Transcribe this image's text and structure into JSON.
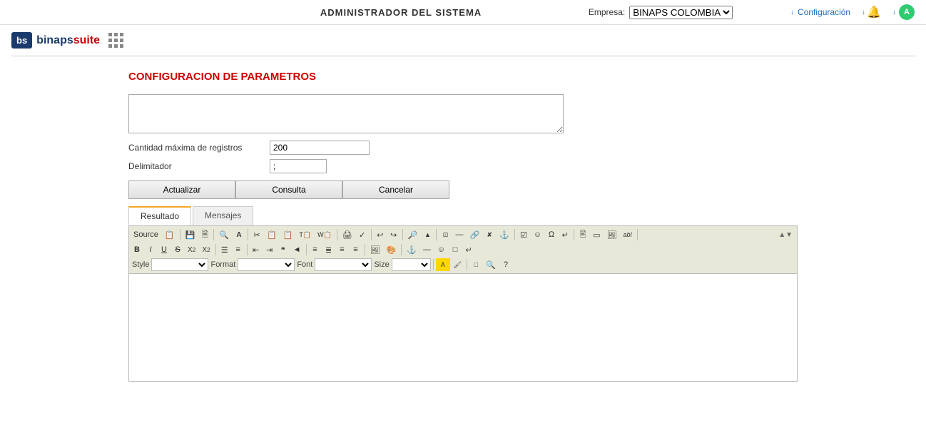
{
  "topbar": {
    "title": "ADMINISTRADOR DEL SISTEMA",
    "empresa_label": "Empresa:",
    "empresa_value": "BINAPS COLOMBIA",
    "empresa_options": [
      "BINAPS COLOMBIA"
    ],
    "configuracion_label": "Configuración",
    "notif_icon": "bell-icon",
    "user_letter": "A"
  },
  "logo": {
    "bs_text": "bs",
    "brand_text1": "binaps",
    "brand_text2": "suite"
  },
  "page": {
    "section_title": "CONFIGURACION DE PARAMETROS"
  },
  "form": {
    "cantidad_label": "Cantidad máxima de registros",
    "cantidad_value": "200",
    "delimitador_label": "Delimitador",
    "delimitador_value": ";"
  },
  "buttons": {
    "actualizar": "Actualizar",
    "consulta": "Consulta",
    "cancelar": "Cancelar"
  },
  "tabs": [
    {
      "label": "Resultado",
      "active": true
    },
    {
      "label": "Mensajes",
      "active": false
    }
  ],
  "editor": {
    "toolbar_row1": [
      {
        "type": "btn",
        "label": "Source",
        "name": "source-btn"
      },
      {
        "type": "btn",
        "icon": "📋",
        "name": "copy-btn"
      },
      {
        "type": "sep"
      },
      {
        "type": "btn",
        "icon": "💾",
        "name": "save-btn"
      },
      {
        "type": "btn",
        "icon": "📄",
        "name": "new-btn"
      },
      {
        "type": "sep"
      },
      {
        "type": "btn",
        "icon": "🔍",
        "name": "find-btn"
      },
      {
        "type": "btn",
        "icon": "A",
        "name": "select-all-btn"
      },
      {
        "type": "sep"
      },
      {
        "type": "btn",
        "icon": "✂",
        "name": "cut-btn"
      },
      {
        "type": "btn",
        "icon": "📋",
        "name": "copy2-btn"
      },
      {
        "type": "btn",
        "icon": "📋",
        "name": "paste-btn"
      },
      {
        "type": "btn",
        "icon": "📋",
        "name": "paste-text-btn"
      },
      {
        "type": "btn",
        "icon": "📋",
        "name": "paste-word-btn"
      },
      {
        "type": "sep"
      },
      {
        "type": "btn",
        "icon": "🖨",
        "name": "print-btn"
      },
      {
        "type": "btn",
        "icon": "✓",
        "name": "spell-btn"
      },
      {
        "type": "sep"
      },
      {
        "type": "btn",
        "icon": "↩",
        "name": "undo-btn"
      },
      {
        "type": "btn",
        "icon": "↪",
        "name": "redo-btn"
      },
      {
        "type": "sep"
      },
      {
        "type": "btn",
        "icon": "🔎",
        "name": "find2-btn"
      },
      {
        "type": "btn",
        "icon": "▲",
        "name": "replace-btn"
      }
    ],
    "toolbar_row2": [
      {
        "type": "btn",
        "icon": "B",
        "name": "bold-btn",
        "style": "bold"
      },
      {
        "type": "btn",
        "icon": "I",
        "name": "italic-btn",
        "style": "italic"
      },
      {
        "type": "btn",
        "icon": "U",
        "name": "underline-btn",
        "style": "underline"
      },
      {
        "type": "btn",
        "icon": "S",
        "name": "strike-btn",
        "style": "strike"
      },
      {
        "type": "btn",
        "icon": "X₂",
        "name": "sub-btn"
      },
      {
        "type": "btn",
        "icon": "X²",
        "name": "sup-btn"
      },
      {
        "type": "sep"
      },
      {
        "type": "btn",
        "icon": "≡",
        "name": "ordered-list-btn"
      },
      {
        "type": "btn",
        "icon": "☰",
        "name": "unordered-list-btn"
      },
      {
        "type": "sep"
      },
      {
        "type": "btn",
        "icon": "⬅",
        "name": "outdent-btn"
      },
      {
        "type": "btn",
        "icon": "➡",
        "name": "indent-btn"
      },
      {
        "type": "btn",
        "icon": "❝",
        "name": "blockquote-btn"
      },
      {
        "type": "btn",
        "icon": "◀",
        "name": "dir-ltr-btn"
      },
      {
        "type": "sep"
      },
      {
        "type": "btn",
        "icon": "◀",
        "name": "align-left-btn"
      },
      {
        "type": "btn",
        "icon": "▶",
        "name": "align-center-btn"
      },
      {
        "type": "btn",
        "icon": "▶▶",
        "name": "align-right-btn"
      },
      {
        "type": "btn",
        "icon": "▶|◀",
        "name": "align-justify-btn"
      },
      {
        "type": "sep"
      },
      {
        "type": "btn",
        "icon": "🖼",
        "name": "image-btn"
      },
      {
        "type": "btn",
        "icon": "🎨",
        "name": "color-btn"
      }
    ],
    "toolbar_row3_selects": [
      {
        "label": "Style",
        "name": "style-select",
        "options": [
          ""
        ]
      },
      {
        "label": "Format",
        "name": "format-select",
        "options": [
          ""
        ]
      },
      {
        "label": "Font",
        "name": "font-select",
        "options": [
          ""
        ]
      },
      {
        "label": "Size",
        "name": "size-select",
        "options": [
          ""
        ]
      }
    ]
  }
}
